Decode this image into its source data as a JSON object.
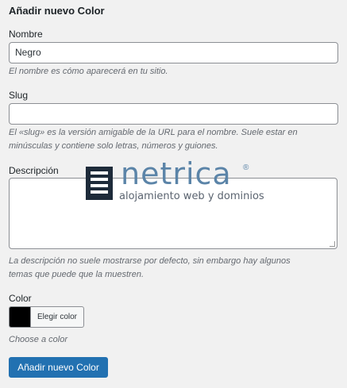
{
  "form": {
    "title": "Añadir nuevo Color",
    "name": {
      "label": "Nombre",
      "value": "Negro",
      "help": "El nombre es cómo aparecerá en tu sitio."
    },
    "slug": {
      "label": "Slug",
      "value": "",
      "help_line1": "El «slug» es la versión amigable de la URL para el nombre. Suele estar en",
      "help_line2": "minúsculas y contiene solo letras, números y guiones."
    },
    "description": {
      "label": "Descripción",
      "value": "",
      "help_line1": "La descripción no suele mostrarse por defecto, sin embargo hay algunos",
      "help_line2": "temas que puede que la muestren."
    },
    "color": {
      "label": "Color",
      "swatch_color": "#000000",
      "picker_label": "Elegir color",
      "help": "Choose a color"
    },
    "submit_label": "Añadir nuevo Color"
  },
  "watermark": {
    "brand": "netrica",
    "registered": "®",
    "tagline": "alojamiento web y dominios",
    "color": "#5b84a8"
  },
  "colors": {
    "background": "#f1f1f1",
    "primary_button": "#2271b1"
  }
}
